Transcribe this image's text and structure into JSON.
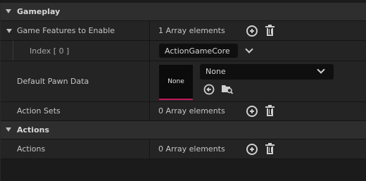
{
  "categories": {
    "gameplay": "Gameplay",
    "actions": "Actions"
  },
  "rows": {
    "game_features": {
      "label": "Game Features to Enable",
      "value": "1 Array elements"
    },
    "index0": {
      "label": "Index [ 0 ]",
      "value": "ActionGameCore"
    },
    "default_pawn": {
      "label": "Default Pawn Data",
      "thumb": "None",
      "value": "None"
    },
    "action_sets": {
      "label": "Action Sets",
      "value": "0 Array elements"
    },
    "actions": {
      "label": "Actions",
      "value": "0 Array elements"
    }
  },
  "icons": [
    "add-icon",
    "trash-icon",
    "chevron-down-icon",
    "use-selected-icon",
    "browse-icon",
    "expand-arrow-icon"
  ],
  "colors": {
    "accent_underline": "#c2185b"
  }
}
